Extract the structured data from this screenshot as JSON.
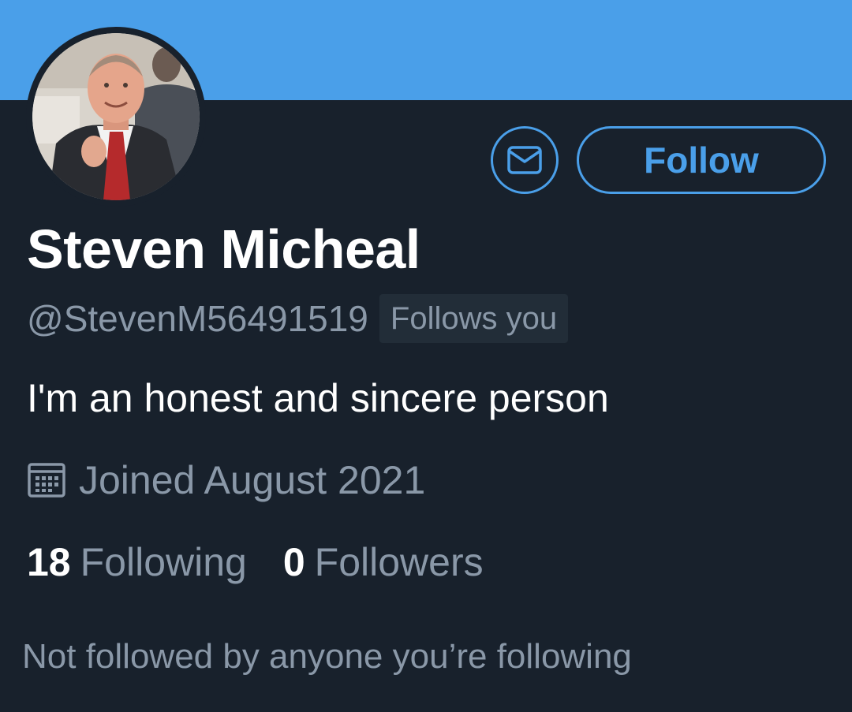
{
  "colors": {
    "banner": "#4a9fe9",
    "background": "#18212c",
    "accent": "#4a9fe9",
    "text_primary": "#ffffff",
    "text_secondary": "#8a98a8"
  },
  "profile": {
    "avatar_icon": "profile-photo",
    "display_name": "Steven Micheal",
    "handle": "@StevenM56491519",
    "follows_you_badge": "Follows you",
    "bio": "I'm an honest and sincere person",
    "joined": "Joined August 2021",
    "joined_icon": "calendar-icon"
  },
  "actions": {
    "message_icon": "mail-icon",
    "follow_label": "Follow"
  },
  "stats": {
    "following_count": "18",
    "following_label": "Following",
    "followers_count": "0",
    "followers_label": "Followers"
  },
  "mutuals_text": "Not followed by anyone you’re following"
}
